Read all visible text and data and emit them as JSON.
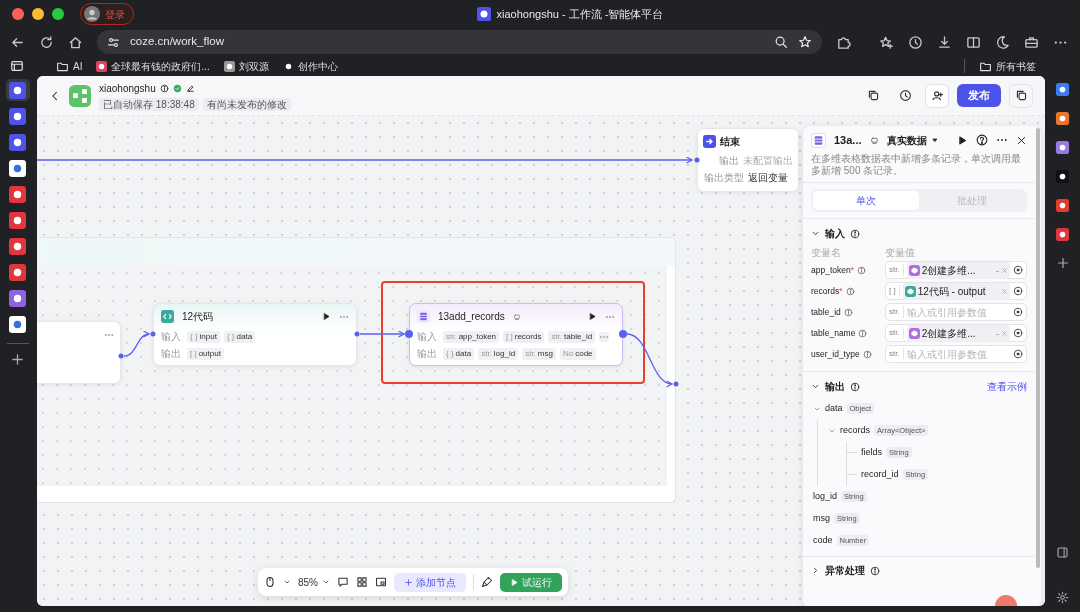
{
  "browser": {
    "profile_label": "登录",
    "tab_title": "xiaohongshu - 工作流 -智能体平台",
    "url": "coze.cn/work_flow",
    "bookmarks": [
      {
        "label": "AI",
        "kind": "folder"
      },
      {
        "label": "全球最有钱的政府们...",
        "kind": "site"
      },
      {
        "label": "刘双源",
        "kind": "site"
      },
      {
        "label": "创作中心",
        "kind": "site"
      }
    ],
    "bookmarks_folder": "所有书签"
  },
  "header": {
    "title": "xiaohongshu",
    "status_tags": [
      "已自动保存 18:38:48",
      "有尚未发布的修改"
    ],
    "publish_button": "发布"
  },
  "canvas": {
    "end_node": {
      "title": "结束",
      "rows": [
        {
          "label": "输出",
          "value": "未配置输出",
          "muted": true
        },
        {
          "label": "输出类型",
          "value": "返回变量",
          "muted": false
        }
      ]
    },
    "nodes": [
      {
        "title": "12代码",
        "kind": "code",
        "highlighted": false,
        "input_label": "输入",
        "output_label": "输出",
        "inputs": [
          {
            "type": "{ }",
            "name": "input"
          },
          {
            "type": "{ }",
            "name": "data"
          }
        ],
        "outputs": [
          {
            "type": "[ ]",
            "name": "output"
          }
        ]
      },
      {
        "title": "13add_records",
        "kind": "table",
        "highlighted": true,
        "input_label": "输入",
        "output_label": "输出",
        "inputs": [
          {
            "type": "str.",
            "name": "app_token"
          },
          {
            "type": "[ ]",
            "name": "records"
          },
          {
            "type": "str.",
            "name": "table_id"
          }
        ],
        "outputs": [
          {
            "type": "{ }",
            "name": "data"
          },
          {
            "type": "str.",
            "name": "log_id"
          },
          {
            "type": "str.",
            "name": "msg"
          },
          {
            "type": "No",
            "name": "code"
          }
        ]
      }
    ]
  },
  "panel": {
    "title": "13a...",
    "mode": "真实数据",
    "description": "在多维表格数据表中新增多条记录，单次调用最多新增 500 条记录。",
    "tabs": [
      {
        "label": "单次",
        "selected": true
      },
      {
        "label": "批处理",
        "selected": false
      }
    ],
    "input": {
      "title": "输入",
      "expanded": true,
      "columns": [
        "变量名",
        "变量值"
      ],
      "params": [
        {
          "name": "app_token",
          "required_mark": "*",
          "type": "str.",
          "ref_label": "2创建多维...",
          "ref_suffix": "-",
          "color": "#b36ae2"
        },
        {
          "name": "records",
          "required_mark": "*",
          "type": "[ ]",
          "ref_label": "12代码 - output",
          "color": "#3aa89c"
        },
        {
          "name": "table_id",
          "type": "str.",
          "placeholder": "输入或引用参数值"
        },
        {
          "name": "table_name",
          "type": "str.",
          "ref_label": "2创建多维...",
          "ref_suffix": "-",
          "color": "#b36ae2"
        },
        {
          "name": "user_id_type",
          "type": "str.",
          "placeholder": "输入或引用参数值"
        }
      ]
    },
    "output": {
      "title": "输出",
      "expanded": true,
      "link": "查看示例",
      "tree": [
        {
          "name": "data",
          "type": "Object",
          "expanded": true,
          "children": [
            {
              "name": "records",
              "type": "Array<Object>",
              "expanded": true,
              "children": [
                {
                  "name": "fields",
                  "type": "String"
                },
                {
                  "name": "record_id",
                  "type": "String"
                }
              ]
            }
          ]
        },
        {
          "name": "log_id",
          "type": "String"
        },
        {
          "name": "msg",
          "type": "String"
        },
        {
          "name": "code",
          "type": "Number"
        }
      ]
    },
    "exception": {
      "title": "异常处理",
      "expanded": false
    }
  },
  "toolbar": {
    "zoom": "85%",
    "add_node_button": "添加节点",
    "run_button": "试运行"
  }
}
